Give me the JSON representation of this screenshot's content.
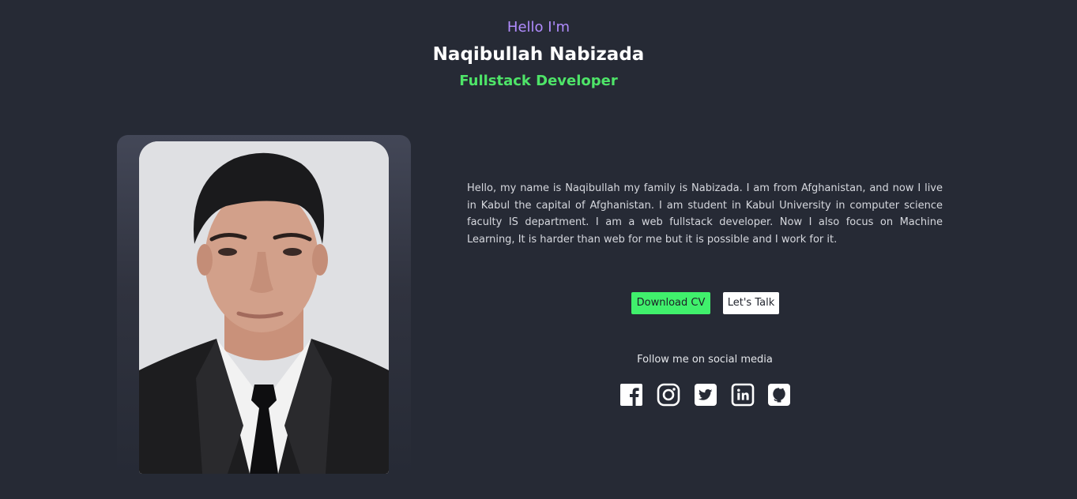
{
  "hero": {
    "greeting": "Hello I'm",
    "name": "Naqibullah Nabizada",
    "role": "Fullstack Developer"
  },
  "about": {
    "bio": "Hello, my name is Naqibullah my family is Nabizada. I am from Afghanistan, and now I live in Kabul the capital of Afghanistan. I am student in Kabul University in computer science faculty IS department. I am a web fullstack developer. Now I also focus on Machine Learning, It is harder than web for me but it is possible and I work for it."
  },
  "actions": {
    "download_cv": "Download CV",
    "lets_talk": "Let's Talk"
  },
  "social": {
    "heading": "Follow me on social media",
    "icons": [
      "facebook-icon",
      "instagram-icon",
      "twitter-icon",
      "linkedin-icon",
      "github-icon"
    ]
  },
  "colors": {
    "background": "#262a35",
    "greeting": "#b18cff",
    "role": "#4ee468",
    "primary_button": "#40f06c"
  }
}
